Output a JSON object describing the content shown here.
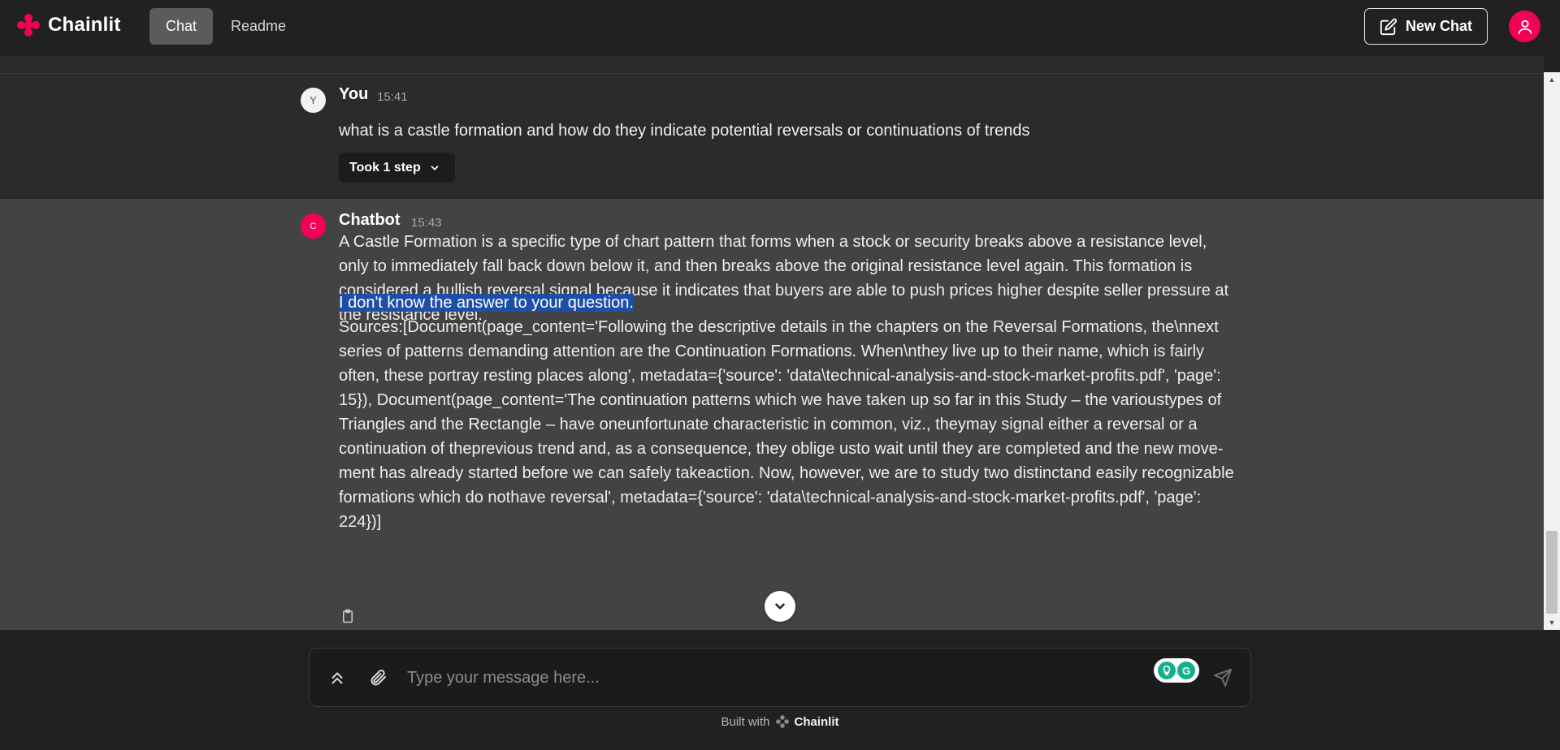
{
  "header": {
    "app_name": "Chainlit",
    "tabs": [
      {
        "label": "Chat",
        "active": true
      },
      {
        "label": "Readme",
        "active": false
      }
    ],
    "new_chat_label": "New Chat",
    "accent_color": "#f50057"
  },
  "messages": {
    "user": {
      "avatar_letter": "Y",
      "author": "You",
      "time": "15:41",
      "text": "what is a castle formation and how do they indicate potential reversals or continuations of trends",
      "step_label": "Took 1 step"
    },
    "bot": {
      "avatar_letter": "C",
      "author": "Chatbot",
      "time": "15:43",
      "paragraph1": "A Castle Formation is a specific type of chart pattern that forms when a stock or security breaks above a resistance level, only to immediately fall back down below it, and then breaks above the original resistance level again. This formation is considered a bullish reversal signal because it indicates that buyers are able to push prices higher despite seller pressure at the resistance level.",
      "selected_line": "I don't know the answer to your question.",
      "sources": "Sources:[Document(page_content='Following the descriptive details in the chapters on the Reversal Formations, the\\nnext series of patterns demanding attention are the Continuation Formations. When\\nthey live up to their name, which is fairly often, these portray resting places along', metadata={'source': 'data\\technical-analysis-and-stock-market-profits.pdf', 'page': 15}), Document(page_content='The continuation patterns which we have taken up so far in this Study – the varioustypes of Triangles and the Rectangle – have oneunfortunate characteristic in common, viz., theymay signal either a reversal or a continuation of theprevious trend and, as a consequence, they oblige usto wait until they are completed and the new move-ment has already started before we can safely takeaction. Now, however, we are to study two distinctand easily recognizable formations which do nothave reversal', metadata={'source': 'data\\technical-analysis-and-stock-market-profits.pdf', 'page': 224})]"
    }
  },
  "composer": {
    "placeholder": "Type your message here..."
  },
  "footer": {
    "built_with": "Built with",
    "brand": "Chainlit"
  }
}
